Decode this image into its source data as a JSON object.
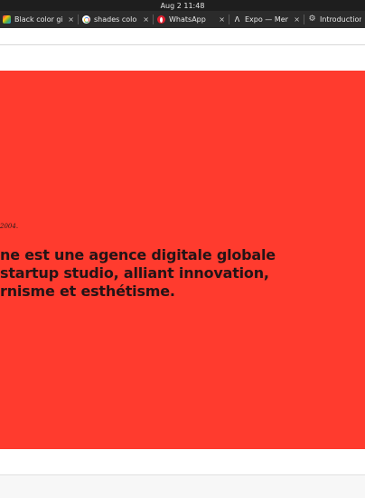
{
  "os_bar": {
    "datetime": "Aug 2  11:48"
  },
  "tabs": [
    {
      "title": "Black color gif",
      "icon": "color-grid-icon"
    },
    {
      "title": "shades color c",
      "icon": "google-icon"
    },
    {
      "title": "WhatsApp",
      "icon": "opera-icon"
    },
    {
      "title": "Expo — Memb",
      "icon": "expo-icon"
    },
    {
      "title": "Introduction t",
      "icon": "gear-icon"
    }
  ],
  "tab_close_glyph": "×",
  "hero": {
    "date_fragment": "2004.",
    "headline_lines": [
      "ne est une agence digitale globale",
      "startup studio, alliant innovation,",
      "rnisme et esthétisme."
    ],
    "background_color": "#ff3b2e",
    "text_color": "#241416"
  }
}
